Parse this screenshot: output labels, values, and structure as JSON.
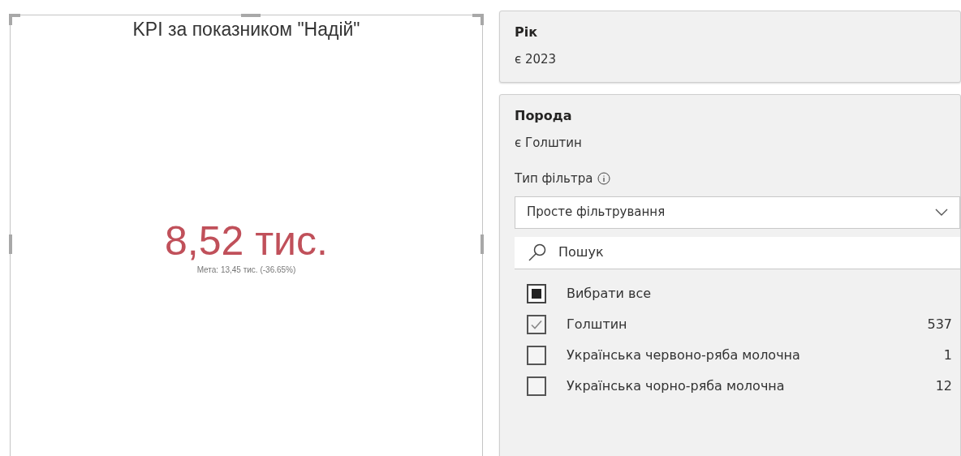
{
  "kpi": {
    "title": "KPI за показником \"Надій\"",
    "value": "8,52 тис.",
    "goal": "Мета: 13,45 тис. (-36.65%)"
  },
  "filters": [
    {
      "kind": "collapsed",
      "name": "Рік",
      "summary": "є 2023"
    },
    {
      "kind": "expanded",
      "name": "Порода",
      "summary": "є Голштин",
      "type_label": "Тип фільтра",
      "type_value": "Просте фільтрування",
      "search": {
        "placeholder": "Пошук"
      },
      "select_all": {
        "label": "Вибрати все",
        "partial": true
      },
      "items": [
        {
          "label": "Голштин",
          "count": "537",
          "checked": true
        },
        {
          "label": "Українська червоно-ряба молочна",
          "count": "1",
          "checked": false
        },
        {
          "label": "Українська чорно-ряба молочна",
          "count": "12",
          "checked": false
        }
      ]
    }
  ]
}
